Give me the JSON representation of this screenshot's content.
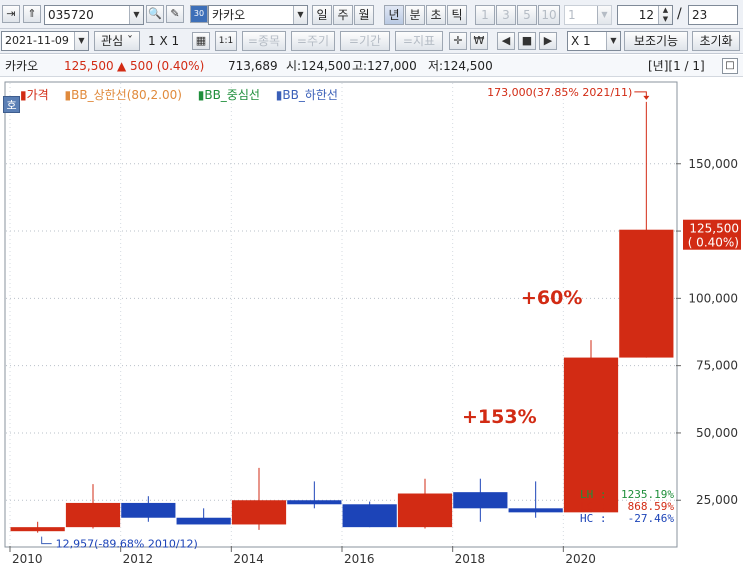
{
  "toolbar": {
    "code": "035720",
    "stock_name": "카카오",
    "period_buttons": [
      "일",
      "주",
      "월",
      "년",
      "분",
      "초",
      "틱"
    ],
    "num_buttons": [
      "1",
      "3",
      "5",
      "10",
      "1"
    ],
    "count_value": "12",
    "slash": "/",
    "total_value": "23"
  },
  "toolbar2": {
    "date": "2021-11-09",
    "interest": "관심",
    "grid": "1 X 1",
    "mode_1to1": "1:1",
    "btn_stock": "=종목",
    "btn_period": "=주기",
    "btn_term": "=기간",
    "btn_indicator": "=지표",
    "multiplier": "X 1",
    "aux": "보조기능",
    "reset": "초기화"
  },
  "info": {
    "name": "카카오",
    "price": "125,500",
    "change": "▲ 500 (0.40%)",
    "volume": "713,689",
    "open": "시:124,500",
    "high": "고:127,000",
    "low": "저:124,500",
    "page": "[년][1 / 1]"
  },
  "legend": {
    "price": "가격",
    "bb_upper": "BB_상한선(80,2.00)",
    "bb_mid": "BB_중심선",
    "bb_lower": "BB_하한선",
    "ho": "호"
  },
  "chart_data": {
    "type": "candlestick",
    "x": [
      "2010",
      "2011",
      "2012",
      "2013",
      "2014",
      "2015",
      "2016",
      "2017",
      "2018",
      "2019",
      "2020",
      "2021"
    ],
    "open": [
      13500,
      15000,
      24000,
      18500,
      16000,
      25000,
      23500,
      15000,
      28000,
      22000,
      20500,
      78000
    ],
    "high": [
      17000,
      31000,
      26500,
      22000,
      37000,
      32000,
      24500,
      33000,
      33000,
      32000,
      84500,
      173000
    ],
    "low": [
      12957,
      14500,
      17000,
      16500,
      14000,
      22000,
      15000,
      14500,
      17000,
      18500,
      20500,
      78000
    ],
    "close": [
      15000,
      24000,
      18500,
      16000,
      25000,
      23500,
      15000,
      27500,
      22000,
      20500,
      78000,
      125500
    ],
    "x_ticks": [
      "2010",
      "2012",
      "2014",
      "2016",
      "2018",
      "2020"
    ],
    "y_ticks": [
      25000,
      50000,
      75000,
      100000,
      125000,
      150000
    ],
    "y_tick_labels": [
      "25,000",
      "50,000",
      "75,000",
      "100,000",
      "125,000",
      "150,000"
    ],
    "ylim": [
      8000,
      180000
    ],
    "up_color": "#d22b14",
    "down_color": "#1c44b8",
    "annotations": {
      "max_label": "173,000(37.85% 2021/11)",
      "min_label": "12,957(-89.68% 2010/12)",
      "gain_2020": "+153%",
      "gain_2021": "+60%",
      "last_price": "125,500",
      "last_change": "( 0.40%)"
    },
    "stats": [
      {
        "key": "LH",
        "value": "1235.19%",
        "color": "#1f8f3b"
      },
      {
        "key": "LC",
        "value": "868.59%",
        "color": "#d22b14"
      },
      {
        "key": "HC",
        "value": "-27.46%",
        "color": "#1c44b8"
      }
    ]
  }
}
